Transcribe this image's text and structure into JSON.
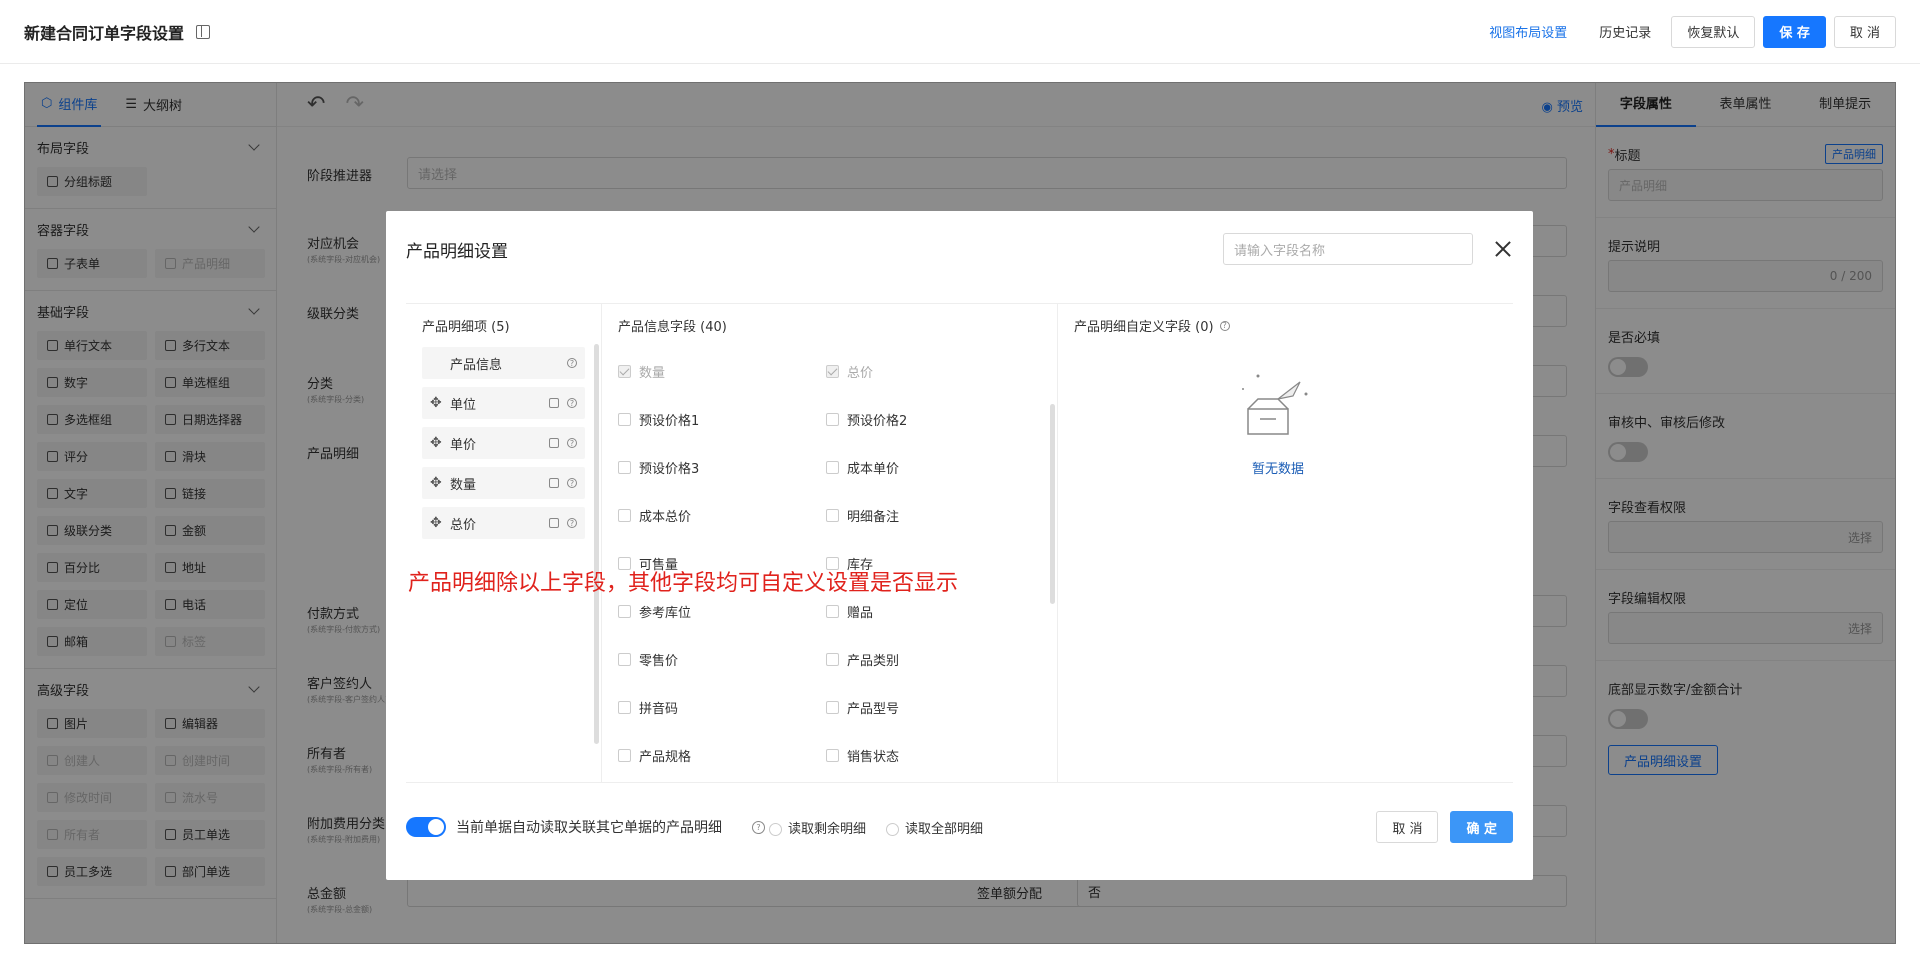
{
  "header": {
    "title": "新建合同订单字段设置",
    "view_layout": "视图布局设置",
    "history": "历史记录",
    "restore": "恢复默认",
    "save": "保 存",
    "cancel": "取 消"
  },
  "left_panel": {
    "tabs": [
      "组件库",
      "大纲树"
    ],
    "sections": [
      {
        "title": "布局字段",
        "items": [
          {
            "label": "分组标题",
            "disabled": false
          }
        ]
      },
      {
        "title": "容器字段",
        "items": [
          {
            "label": "子表单",
            "disabled": false
          },
          {
            "label": "产品明细",
            "disabled": true
          }
        ]
      },
      {
        "title": "基础字段",
        "items": [
          {
            "label": "单行文本",
            "disabled": false
          },
          {
            "label": "多行文本",
            "disabled": false
          },
          {
            "label": "数字",
            "disabled": false
          },
          {
            "label": "单选框组",
            "disabled": false
          },
          {
            "label": "多选框组",
            "disabled": false
          },
          {
            "label": "日期选择器",
            "disabled": false
          },
          {
            "label": "评分",
            "disabled": false
          },
          {
            "label": "滑块",
            "disabled": false
          },
          {
            "label": "文字",
            "disabled": false
          },
          {
            "label": "链接",
            "disabled": false
          },
          {
            "label": "级联分类",
            "disabled": false
          },
          {
            "label": "金额",
            "disabled": false
          },
          {
            "label": "百分比",
            "disabled": false
          },
          {
            "label": "地址",
            "disabled": false
          },
          {
            "label": "定位",
            "disabled": false
          },
          {
            "label": "电话",
            "disabled": false
          },
          {
            "label": "邮箱",
            "disabled": false
          },
          {
            "label": "标签",
            "disabled": true
          }
        ]
      },
      {
        "title": "高级字段",
        "items": [
          {
            "label": "图片",
            "disabled": false
          },
          {
            "label": "编辑器",
            "disabled": false
          },
          {
            "label": "创建人",
            "disabled": true
          },
          {
            "label": "创建时间",
            "disabled": true
          },
          {
            "label": "修改时间",
            "disabled": true
          },
          {
            "label": "流水号",
            "disabled": true
          },
          {
            "label": "所有者",
            "disabled": true
          },
          {
            "label": "员工单选",
            "disabled": false
          },
          {
            "label": "员工多选",
            "disabled": false
          },
          {
            "label": "部门单选",
            "disabled": false
          }
        ]
      }
    ]
  },
  "canvas": {
    "preview": "预览",
    "fields": [
      {
        "label": "阶段推进器",
        "sub": "",
        "placeholder": "请选择"
      },
      {
        "label": "对应机会",
        "sub": "(系统字段-对应机会)",
        "placeholder": ""
      },
      {
        "label": "级联分类",
        "sub": "",
        "placeholder": ""
      },
      {
        "label": "分类",
        "sub": "(系统字段-分类)",
        "placeholder": ""
      },
      {
        "label": "产品明细",
        "sub": "",
        "placeholder": ""
      },
      {
        "label": "付款方式",
        "sub": "(系统字段-付款方式)",
        "placeholder": ""
      },
      {
        "label": "客户签约人",
        "sub": "(系统字段-客户签约人)",
        "placeholder": ""
      },
      {
        "label": "所有者",
        "sub": "(系统字段-所有者)",
        "placeholder": ""
      },
      {
        "label": "附加费用分类",
        "sub": "(系统字段-附加费用)",
        "placeholder": ""
      },
      {
        "label": "总金额",
        "sub": "(系统字段-总金额)",
        "placeholder": ""
      }
    ],
    "split_label": "签单额分配",
    "split_value": "否"
  },
  "right_panel": {
    "tabs": [
      "字段属性",
      "表单属性",
      "制单提示"
    ],
    "title_label": "标题",
    "title_badge": "产品明细",
    "title_value": "产品明细",
    "hint_label": "提示说明",
    "hint_counter": "0 / 200",
    "required_label": "是否必填",
    "edit_label": "审核中、审核后修改",
    "view_perm_label": "字段查看权限",
    "edit_perm_label": "字段编辑权限",
    "select": "选择",
    "sum_label": "底部显示数字/金额合计",
    "detail_btn": "产品明细设置"
  },
  "modal": {
    "title": "产品明细设置",
    "search_placeholder": "请输入字段名称",
    "col1_title": "产品明细项 (5)",
    "col1_items": [
      "产品信息",
      "单位",
      "单价",
      "数量",
      "总价"
    ],
    "col2_title": "产品信息字段 (40)",
    "col2_items": [
      {
        "label": "数量",
        "checked": true,
        "disabled": true
      },
      {
        "label": "总价",
        "checked": true,
        "disabled": true
      },
      {
        "label": "预设价格1",
        "checked": false,
        "disabled": false
      },
      {
        "label": "预设价格2",
        "checked": false,
        "disabled": false
      },
      {
        "label": "预设价格3",
        "checked": false,
        "disabled": false
      },
      {
        "label": "成本单价",
        "checked": false,
        "disabled": false
      },
      {
        "label": "成本总价",
        "checked": false,
        "disabled": false
      },
      {
        "label": "明细备注",
        "checked": false,
        "disabled": false
      },
      {
        "label": "可售量",
        "checked": false,
        "disabled": false
      },
      {
        "label": "库存",
        "checked": false,
        "disabled": false
      },
      {
        "label": "参考库位",
        "checked": false,
        "disabled": false
      },
      {
        "label": "赠品",
        "checked": false,
        "disabled": false
      },
      {
        "label": "零售价",
        "checked": false,
        "disabled": false
      },
      {
        "label": "产品类别",
        "checked": false,
        "disabled": false
      },
      {
        "label": "拼音码",
        "checked": false,
        "disabled": false
      },
      {
        "label": "产品型号",
        "checked": false,
        "disabled": false
      },
      {
        "label": "产品规格",
        "checked": false,
        "disabled": false
      },
      {
        "label": "销售状态",
        "checked": false,
        "disabled": false
      }
    ],
    "col3_title": "产品明细自定义字段 (0)",
    "empty_text": "暂无数据",
    "auto_read": "当前单据自动读取关联其它单据的产品明细",
    "opt_remaining": "读取剩余明细",
    "opt_all": "读取全部明细",
    "cancel": "取 消",
    "confirm": "确 定"
  },
  "annotation": "产品明细除以上字段，其他字段均可自定义设置是否显示",
  "colors": {
    "primary": "#1677ff",
    "annotation": "#e0221c"
  }
}
